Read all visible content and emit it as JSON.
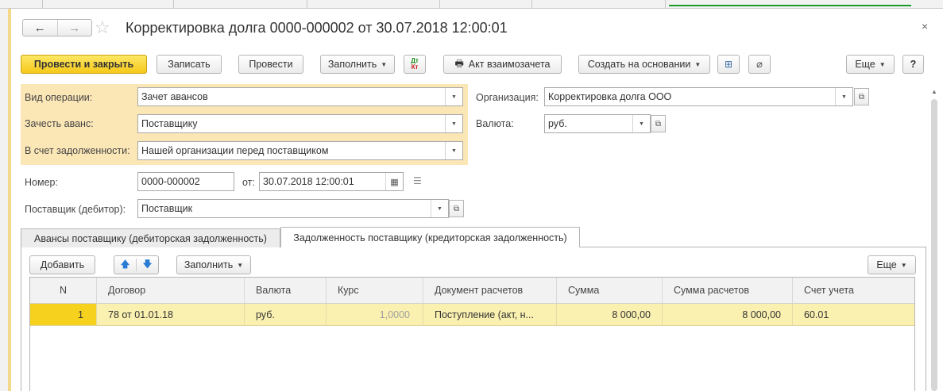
{
  "header": {
    "back_icon": "←",
    "forward_icon": "→",
    "star_icon": "☆",
    "title": "Корректировка долга 0000-000002 от 30.07.2018 12:00:01",
    "close_icon": "×"
  },
  "toolbar": {
    "post_close": "Провести и закрыть",
    "save": "Записать",
    "post": "Провести",
    "fill": "Заполнить",
    "dtkt_top": "Дт",
    "dtkt_bottom": "Кт",
    "netting_act": "Акт взаимозачета",
    "create_based": "Создать на основании",
    "more": "Еще",
    "help": "?"
  },
  "form": {
    "operation_label": "Вид операции:",
    "operation_value": "Зачет авансов",
    "advance_label": "Зачесть аванс:",
    "advance_value": "Поставщику",
    "debt_label": "В счет задолженности:",
    "debt_value": "Нашей организации перед поставщиком",
    "org_label": "Организация:",
    "org_value": "Корректировка долга ООО",
    "currency_label": "Валюта:",
    "currency_value": "руб.",
    "number_label": "Номер:",
    "number_value": "0000-000002",
    "date_label": "от:",
    "date_value": "30.07.2018 12:00:01",
    "supplier_label": "Поставщик (дебитор):",
    "supplier_value": "Поставщик"
  },
  "tabs": [
    {
      "label": "Авансы поставщику (дебиторская задолженность)",
      "active": false
    },
    {
      "label": "Задолженность поставщику (кредиторская задолженность)",
      "active": true
    }
  ],
  "table_toolbar": {
    "add": "Добавить",
    "fill": "Заполнить",
    "more": "Еще"
  },
  "table": {
    "columns": [
      "N",
      "Договор",
      "Валюта",
      "Курс",
      "Документ расчетов",
      "Сумма",
      "Сумма расчетов",
      "Счет учета"
    ],
    "rows": [
      [
        "1",
        "78 от 01.01.18",
        "руб.",
        "1,0000",
        "Поступление (акт, н...",
        "8 000,00",
        "8 000,00",
        "60.01"
      ]
    ]
  },
  "colors": {
    "primary_button": "#f5c91a",
    "highlight_panel": "#fbe6b6",
    "selected_row": "#faf0b0"
  }
}
